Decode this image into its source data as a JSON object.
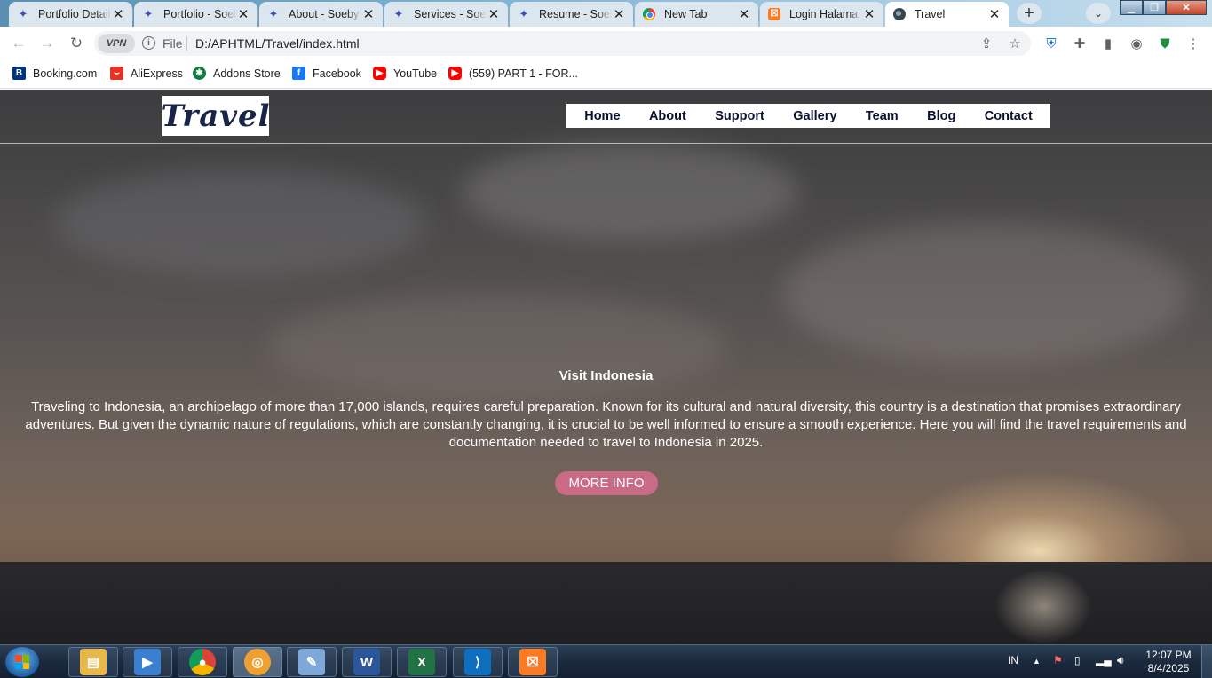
{
  "browser": {
    "tabs": [
      {
        "title": "Portfolio Details",
        "icon": "sparkle-icon"
      },
      {
        "title": "Portfolio - Soeby",
        "icon": "sparkle-icon"
      },
      {
        "title": "About - Soeby",
        "icon": "sparkle-icon"
      },
      {
        "title": "Services - Soeby",
        "icon": "sparkle-icon"
      },
      {
        "title": "Resume - Soeby",
        "icon": "sparkle-icon"
      },
      {
        "title": "New Tab",
        "icon": "chrome-icon"
      },
      {
        "title": "Login Halaman",
        "icon": "xampp-icon"
      },
      {
        "title": "Travel",
        "icon": "globe-icon",
        "active": true
      }
    ],
    "address": {
      "vpn_label": "VPN",
      "scheme_label": "File",
      "url": "D:/APHTML/Travel/index.html"
    },
    "bookmarks": [
      {
        "label": "Booking.com",
        "icon": "booking-icon",
        "color": "#003580"
      },
      {
        "label": "AliExpress",
        "icon": "aliexpress-icon",
        "color": "#e43225"
      },
      {
        "label": "Addons Store",
        "icon": "addons-store-icon",
        "color": "#0f7b3e"
      },
      {
        "label": "Facebook",
        "icon": "facebook-icon",
        "color": "#1877f2"
      },
      {
        "label": "YouTube",
        "icon": "youtube-icon",
        "color": "#ff0000"
      },
      {
        "label": "(559) PART 1 - FOR...",
        "icon": "youtube-icon",
        "color": "#ff0000"
      }
    ]
  },
  "site": {
    "logo_text": "Travel",
    "nav": [
      "Home",
      "About",
      "Support",
      "Gallery",
      "Team",
      "Blog",
      "Contact"
    ],
    "hero": {
      "title": "Visit Indonesia",
      "text": "Traveling to Indonesia, an archipelago of more than 17,000 islands, requires careful preparation. Known for its cultural and natural diversity, this country is a destination that promises extraordinary adventures. But given the dynamic nature of regulations, which are constantly changing, it is crucial to be well informed to ensure a smooth experience. Here you will find the travel requirements and documentation needed to travel to Indonesia in 2025.",
      "button": "MORE INFO"
    }
  },
  "taskbar": {
    "lang": "IN",
    "time": "12:07 PM",
    "date": "8/4/2025"
  }
}
